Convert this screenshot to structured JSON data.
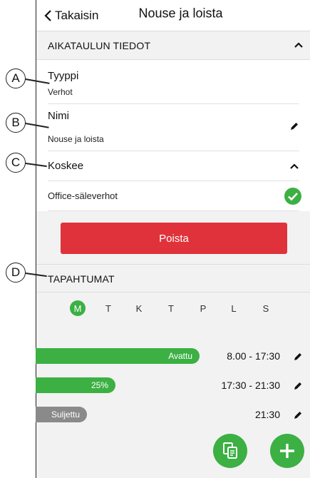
{
  "header": {
    "back_label": "Takaisin",
    "title": "Nouse ja loista"
  },
  "schedule_section": {
    "label": "AIKATAULUN TIEDOT"
  },
  "type_field": {
    "label": "Tyyppi",
    "value": "Verhot"
  },
  "name_field": {
    "label": "Nimi",
    "value": "Nouse ja loista"
  },
  "applies_to": {
    "label": "Koskee",
    "device": "Office-säleverhot"
  },
  "delete_button": {
    "label": "Poista"
  },
  "events_section": {
    "label": "TAPAHTUMAT"
  },
  "days": [
    "M",
    "T",
    "K",
    "T",
    "P",
    "L",
    "S"
  ],
  "active_day_index": 0,
  "events": [
    {
      "label": "Avattu",
      "time": "8.00 - 17:30",
      "level": 1.0,
      "color": "#3cb043"
    },
    {
      "label": "25%",
      "time": "17:30 - 21:30",
      "level": 0.25,
      "color": "#3cb043"
    },
    {
      "label": "Suljettu",
      "time": "21:30",
      "level": 0.0,
      "color": "#8a8a8a"
    }
  ],
  "callouts": [
    "A",
    "B",
    "C",
    "D"
  ],
  "colors": {
    "accent": "#3cb043",
    "danger": "#e0323a"
  }
}
